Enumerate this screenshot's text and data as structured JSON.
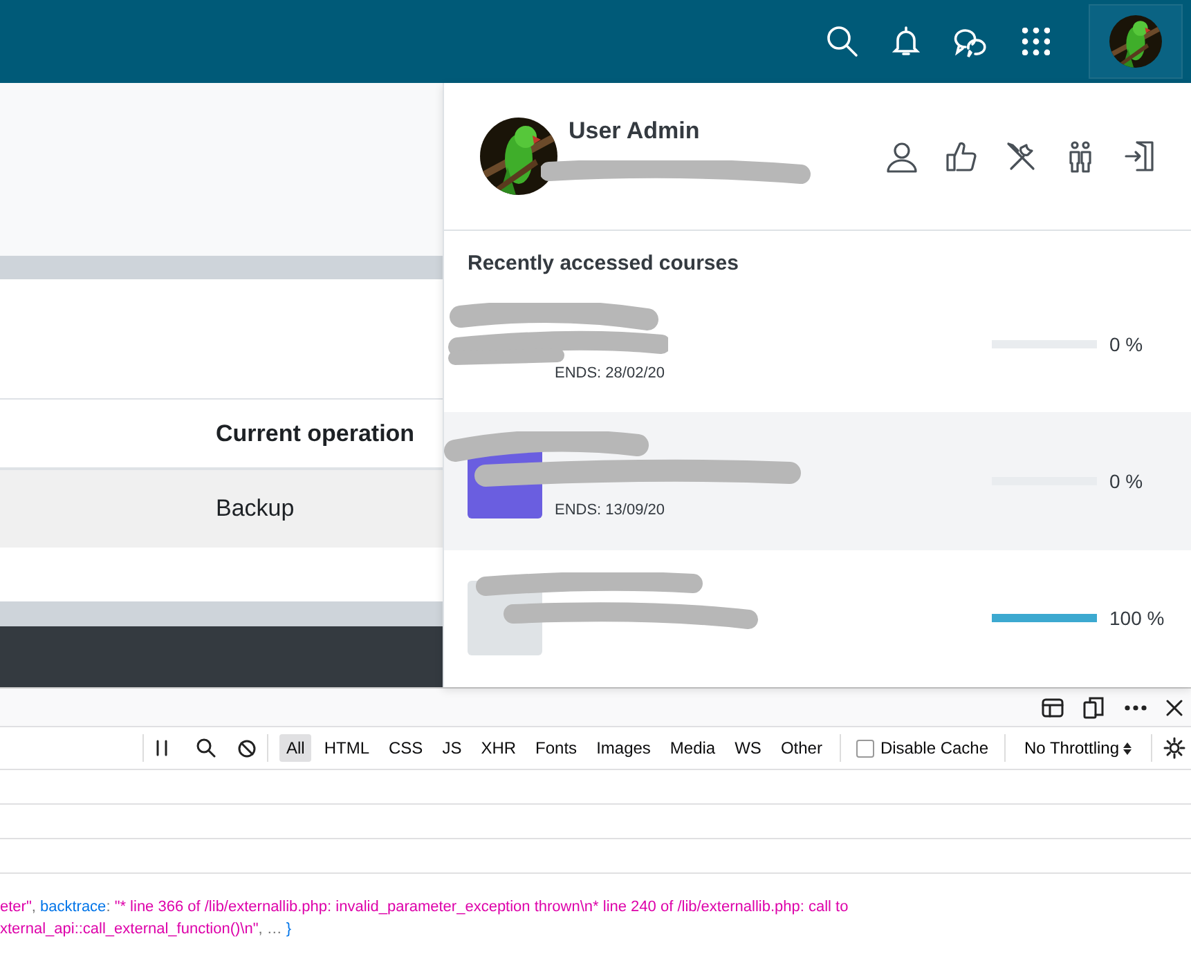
{
  "page": {
    "table": {
      "header": "Current operation",
      "rows": [
        "Backup"
      ]
    }
  },
  "user_menu": {
    "name": "User Admin",
    "section_title": "Recently accessed courses",
    "courses": [
      {
        "end": "ENDS: 28/02/20",
        "level": 0,
        "percent": "0 %",
        "highlighted": false
      },
      {
        "end": "ENDS: 13/09/20",
        "level": 0,
        "percent": "0 %",
        "highlighted": true,
        "color": "#6a5ee0"
      },
      {
        "level": 1,
        "percent": "100 %",
        "highlighted": false,
        "color": "#dfe3e6"
      }
    ]
  },
  "devtools": {
    "filters": [
      {
        "label": "All",
        "selected": true
      },
      {
        "label": "HTML",
        "selected": false
      },
      {
        "label": "CSS",
        "selected": false
      },
      {
        "label": "JS",
        "selected": false
      },
      {
        "label": "XHR",
        "selected": false
      },
      {
        "label": "Fonts",
        "selected": false
      },
      {
        "label": "Images",
        "selected": false
      },
      {
        "label": "Media",
        "selected": false
      },
      {
        "label": "WS",
        "selected": false
      },
      {
        "label": "Other",
        "selected": false
      }
    ],
    "disable_cache": {
      "label": "Disable Cache",
      "checked": false
    },
    "throttling": "No Throttling",
    "console_lines": [
      [
        {
          "kind": "string",
          "text": "eter\""
        },
        {
          "kind": "punct",
          "text": ", "
        },
        {
          "kind": "key",
          "text": "backtrace"
        },
        {
          "kind": "punct",
          "text": ": "
        },
        {
          "kind": "string",
          "text": "\"* line 366 of /lib/externallib.php: invalid_parameter_exception thrown\\n* line 240 of /lib/externallib.php: call to"
        }
      ],
      [
        {
          "kind": "string",
          "text": "xternal_api::call_external_function()\\n\""
        },
        {
          "kind": "punct",
          "text": ", … "
        },
        {
          "kind": "key",
          "text": "}"
        }
      ]
    ]
  }
}
